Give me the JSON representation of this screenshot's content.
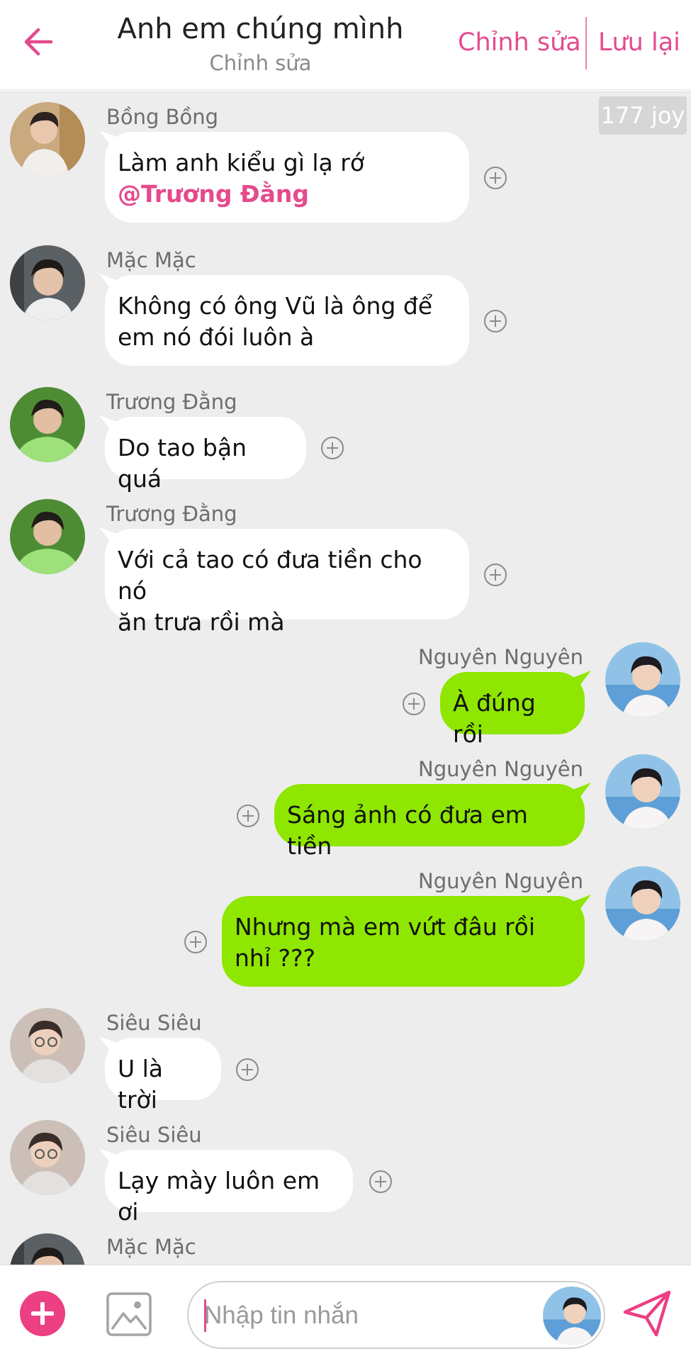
{
  "header": {
    "title": "Anh em chúng mình",
    "subtitle": "Chỉnh sửa",
    "edit_label": "Chỉnh sửa",
    "save_label": "Lưu lại",
    "back_icon": "arrow-left-icon",
    "accent_color": "#e44b8d"
  },
  "badge": {
    "text": "177 joy"
  },
  "messages": [
    {
      "sender": "Bồng Bồng",
      "side": "left",
      "lines": [
        "Làm anh kiểu gì lạ rớ"
      ],
      "mention": "@Trương Đằng"
    },
    {
      "sender": "Mặc Mặc",
      "side": "left",
      "lines": [
        "Không có ông Vũ là ông để",
        "em nó đói luôn à"
      ]
    },
    {
      "sender": "Trương Đằng",
      "side": "left",
      "lines": [
        "Do tao bận quá"
      ]
    },
    {
      "sender": "Trương Đằng",
      "side": "left",
      "lines": [
        "Với cả tao có đưa tiền cho nó",
        "ăn trưa rồi mà"
      ]
    },
    {
      "sender": "Nguyên Nguyên",
      "side": "right",
      "lines": [
        "À đúng rồi"
      ]
    },
    {
      "sender": "Nguyên Nguyên",
      "side": "right",
      "lines": [
        "Sáng ảnh có đưa em tiền"
      ]
    },
    {
      "sender": "Nguyên Nguyên",
      "side": "right",
      "lines": [
        "Nhưng mà em vứt đâu rồi",
        "nhỉ ???"
      ]
    },
    {
      "sender": "Siêu Siêu",
      "side": "left",
      "lines": [
        "U là trời"
      ]
    },
    {
      "sender": "Siêu Siêu",
      "side": "left",
      "lines": [
        "Lạy mày luôn em ơi"
      ]
    },
    {
      "sender": "Mặc Mặc",
      "side": "left",
      "lines": []
    }
  ],
  "composer": {
    "placeholder": "Nhập tin nhắn",
    "value": "",
    "add_icon": "plus-circle-icon",
    "image_icon": "image-icon",
    "send_icon": "send-icon"
  },
  "colors": {
    "chat_background": "#ededed",
    "incoming_bubble": "#ffffff",
    "outgoing_bubble": "#8fe600",
    "mention": "#e44b8d"
  }
}
